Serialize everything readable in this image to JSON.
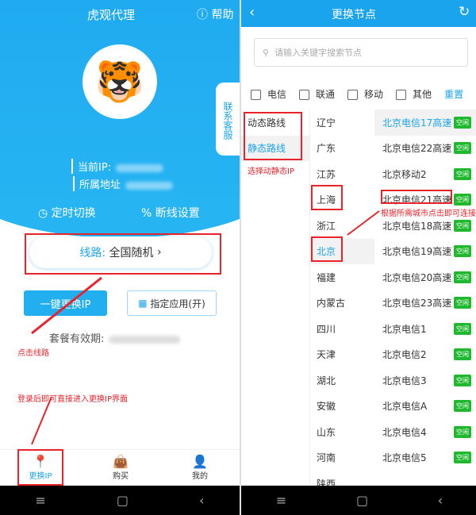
{
  "left": {
    "title": "虎观代理",
    "help": "帮助",
    "side_tab": "联系客服",
    "current_ip_label": "当前IP:",
    "region_label": "所属地址",
    "timer_switch": "定时切换",
    "disconnect_settings": "断线设置",
    "route_label": "线路:",
    "route_value": "全国随机",
    "one_click_change": "一键更换IP",
    "specify_app": "指定应用(开)",
    "plan_validity": "套餐有效期:",
    "annotation_click_route": "点击线路",
    "annotation_login": "登录后即可直接进入更换IP界面",
    "tabs": [
      {
        "label": "更换IP",
        "active": true
      },
      {
        "label": "购买"
      },
      {
        "label": "我的"
      }
    ]
  },
  "right": {
    "title": "更换节点",
    "search_placeholder": "请输入关键字搜索节点",
    "filters": [
      "电信",
      "联通",
      "移动",
      "其他"
    ],
    "reset": "重置",
    "route_types": [
      {
        "label": "动态路线"
      },
      {
        "label": "静态路线",
        "active": true
      }
    ],
    "annotation_route_type": "选择动静态IP",
    "provinces": [
      "辽宁",
      "广东",
      "江苏",
      "上海",
      "浙江",
      "北京",
      "福建",
      "内蒙古",
      "四川",
      "天津",
      "湖北",
      "安徽",
      "山东",
      "河南",
      "陕西"
    ],
    "nodes": [
      "北京电信17高速",
      "北京电信22高速",
      "北京移动2",
      "北京电信21高速",
      "北京电信18高速",
      "北京电信19高速",
      "北京电信20高速",
      "北京电信23高速",
      "北京电信1",
      "北京电信2",
      "北京电信3",
      "北京电信A",
      "北京电信4",
      "北京电信5"
    ],
    "status_free": "空闲",
    "annotation_city": "根据所需城市点击即可连接"
  },
  "colors": {
    "accent": "#1ba4ee",
    "annotation": "#e8232a",
    "free": "#1fb82e"
  }
}
